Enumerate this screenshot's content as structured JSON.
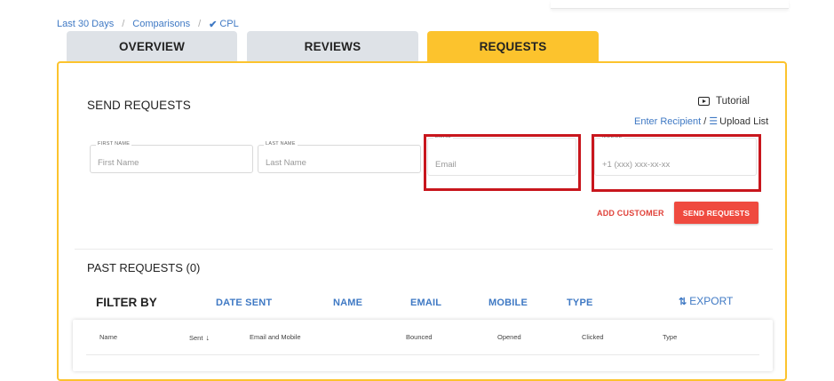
{
  "breadcrumb": {
    "items": [
      "Last 30 Days",
      "Comparisons",
      "CPL"
    ],
    "separator": "/",
    "active_icon": "check-icon"
  },
  "tabs": [
    {
      "label": "OVERVIEW",
      "active": false
    },
    {
      "label": "REVIEWS",
      "active": false
    },
    {
      "label": "REQUESTS",
      "active": true
    }
  ],
  "send": {
    "title": "SEND REQUESTS",
    "tutorial": "Tutorial",
    "enter_recipient": "Enter Recipient",
    "slash": "/",
    "upload_list": "Upload List",
    "fields": {
      "first_name": {
        "label": "FIRST NAME",
        "placeholder": "First Name"
      },
      "last_name": {
        "label": "LAST NAME",
        "placeholder": "Last Name"
      },
      "email": {
        "label": "EMAIL",
        "placeholder": "Email"
      },
      "mobile": {
        "label": "MOBILE",
        "placeholder": "+1 (xxx) xxx-xx-xx"
      }
    },
    "add_customer": "ADD CUSTOMER",
    "send_button": "SEND REQUESTS"
  },
  "past": {
    "title": "PAST REQUESTS (0)",
    "filter_label": "FILTER BY",
    "filters": [
      "DATE SENT",
      "NAME",
      "EMAIL",
      "MOBILE",
      "TYPE"
    ],
    "export": "EXPORT",
    "columns": [
      "Name",
      "Sent",
      "Email and Mobile",
      "Bounced",
      "Opened",
      "Clicked",
      "Type"
    ]
  },
  "colors": {
    "accent": "#fcc32d",
    "link": "#3f79c4",
    "danger": "#ef4a3f",
    "highlight": "#c8161d",
    "tab_inactive": "#dee2e7"
  }
}
